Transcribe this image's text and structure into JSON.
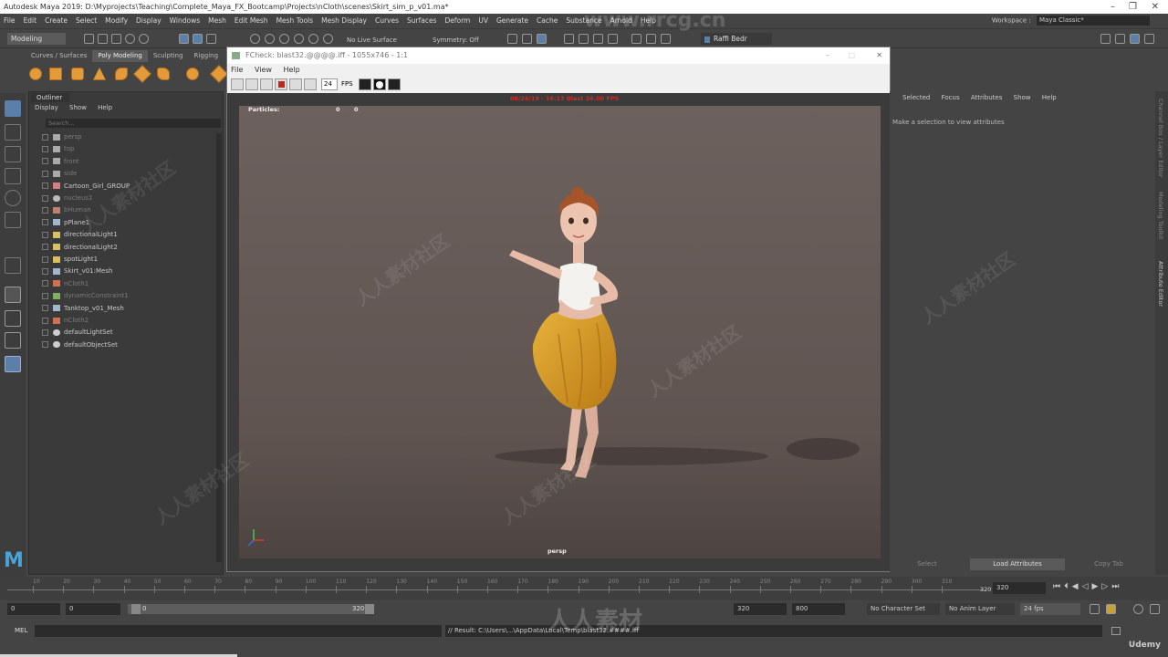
{
  "window": {
    "title": "Autodesk Maya 2019: D:\\Myprojects\\Teaching\\Complete_Maya_FX_Bootcamp\\Projects\\nCloth\\scenes\\Skirt_sim_p_v01.ma*"
  },
  "menubar": [
    "File",
    "Edit",
    "Create",
    "Select",
    "Modify",
    "Display",
    "Windows",
    "Mesh",
    "Edit Mesh",
    "Mesh Tools",
    "Mesh Display",
    "Curves",
    "Surfaces",
    "Deform",
    "UV",
    "Generate",
    "Cache",
    "Substance",
    "Arnold",
    "Help"
  ],
  "workspace": {
    "label": "Workspace :",
    "value": "Maya Classic*"
  },
  "statusline": {
    "mode": "Modeling",
    "live_surface": "No Live Surface",
    "symmetry": "Symmetry: Off",
    "user": "Raffi Bedr"
  },
  "shelf": {
    "tabs": [
      "Curves / Surfaces",
      "Poly Modeling",
      "Sculpting",
      "Rigging"
    ],
    "active_tab": "Poly Modeling"
  },
  "outliner": {
    "tab": "Outliner",
    "menu": [
      "Display",
      "Show",
      "Help"
    ],
    "search_placeholder": "Search...",
    "items": [
      {
        "label": "persp",
        "type": "camera",
        "dim": true
      },
      {
        "label": "top",
        "type": "camera",
        "dim": true
      },
      {
        "label": "front",
        "type": "camera",
        "dim": true
      },
      {
        "label": "side",
        "type": "camera",
        "dim": true
      },
      {
        "label": "Cartoon_Girl_GROUP",
        "type": "group",
        "dim": false
      },
      {
        "label": "nucleus1",
        "type": "nucleus",
        "dim": true
      },
      {
        "label": "bHuman",
        "type": "bhuman",
        "dim": true
      },
      {
        "label": "pPlane1",
        "type": "mesh",
        "dim": false
      },
      {
        "label": "directionalLight1",
        "type": "light",
        "dim": false
      },
      {
        "label": "directionalLight2",
        "type": "light",
        "dim": false
      },
      {
        "label": "spotLight1",
        "type": "spot",
        "dim": false
      },
      {
        "label": "Skirt_v01:Mesh",
        "type": "mesh",
        "dim": false
      },
      {
        "label": "nCloth1",
        "type": "ncloth",
        "dim": true
      },
      {
        "label": "dynamicConstraint1",
        "type": "constraint",
        "dim": true
      },
      {
        "label": "Tanktop_v01_Mesh",
        "type": "mesh",
        "dim": false
      },
      {
        "label": "nCloth2",
        "type": "ncloth",
        "dim": true
      },
      {
        "label": "defaultLightSet",
        "type": "set",
        "dim": false
      },
      {
        "label": "defaultObjectSet",
        "type": "set",
        "dim": false
      }
    ]
  },
  "fcheck": {
    "title": "FCheck: blast32.@@@@.iff - 1055x746 - 1:1",
    "menu": [
      "File",
      "View",
      "Help"
    ],
    "fps_value": "24",
    "fps_label": "FPS",
    "hud_particles_label": "Particles:",
    "hud_particles_values": [
      "0",
      "0"
    ],
    "hud_camera": "persp",
    "hud_top_red": "08/26/19 · 16:17 Blast 24.00 FPS"
  },
  "channelbox": {
    "menu": [
      "Selected",
      "Focus",
      "Attributes",
      "Show",
      "Help"
    ],
    "hint": "Make a selection to view attributes",
    "buttons": [
      "Select",
      "Load Attributes",
      "Copy Tab"
    ],
    "side_tabs": [
      "Channel Box / Layer Editor",
      "Modeling Toolkit",
      "Attribute Editor"
    ]
  },
  "timeslider": {
    "ticks": [
      "10",
      "20",
      "30",
      "40",
      "50",
      "60",
      "70",
      "80",
      "90",
      "100",
      "110",
      "120",
      "130",
      "140",
      "150",
      "160",
      "170",
      "180",
      "190",
      "200",
      "210",
      "220",
      "230",
      "240",
      "250",
      "260",
      "270",
      "280",
      "290",
      "300",
      "310"
    ],
    "current_frame": "320",
    "current_field": "320"
  },
  "rangebar": {
    "start": "0",
    "anim_start": "0",
    "range_start": "0",
    "range_end": "320",
    "end": "320",
    "anim_end": "800",
    "character_set": "No Character Set",
    "anim_layer": "No Anim Layer",
    "fps": "24 fps"
  },
  "cmdline": {
    "label": "MEL",
    "result": "// Result: C:\\Users\\...\\AppData\\Local\\Temp\\blast32.####.iff"
  },
  "branding": {
    "udemy": "Udemy"
  },
  "watermark": {
    "text": "人人素材社区",
    "site": "www.rrcg.cn",
    "bottom": "人人素材"
  }
}
